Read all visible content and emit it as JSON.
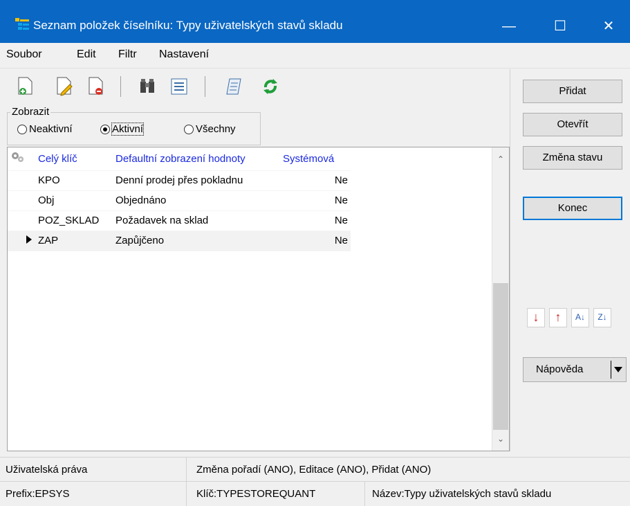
{
  "window": {
    "title": "Seznam položek číselníku: Typy uživatelských stavů skladu",
    "minimize": "—",
    "maximize": "☐",
    "close": "✕"
  },
  "menu": [
    "Soubor",
    "Edit",
    "Filtr",
    "Nastavení"
  ],
  "filter": {
    "legend": "Zobrazit",
    "options": [
      "Neaktivní",
      "Aktivní",
      "Všechny"
    ],
    "selected": "Aktivní"
  },
  "table": {
    "headers": [
      "Celý klíč",
      "Defaultní zobrazení hodnoty",
      "Systémová"
    ],
    "rows": [
      [
        "KPO",
        "Denní prodej přes pokladnu",
        "Ne"
      ],
      [
        "Obj",
        "Objednáno",
        "Ne"
      ],
      [
        "POZ_SKLAD",
        "Požadavek na sklad",
        "Ne"
      ],
      [
        "ZAP",
        "Zapůjčeno",
        "Ne"
      ]
    ],
    "current_row_index": 3
  },
  "buttons": {
    "pridat": "Přidat",
    "otevrit": "Otevřít",
    "zmena_stavu": "Změna stavu",
    "konec": "Konec",
    "napoveda": "Nápověda"
  },
  "status": {
    "rights_label": "Uživatelská práva",
    "rights_value": "Změna pořadí (ANO), Editace (ANO), Přidat (ANO)",
    "prefix": "Prefix:EPSYS",
    "key": "Klíč:TYPESTOREQUANT",
    "name": "Název:Typy uživatelských stavů skladu"
  },
  "colors": {
    "titlebar": "#0a67c3",
    "header_text": "#1a29e0",
    "default_button_border": "#0078d7",
    "sort_down": "#cc1f1f",
    "sort_up": "#cc1f1f",
    "refresh": "#1f9e3a"
  }
}
